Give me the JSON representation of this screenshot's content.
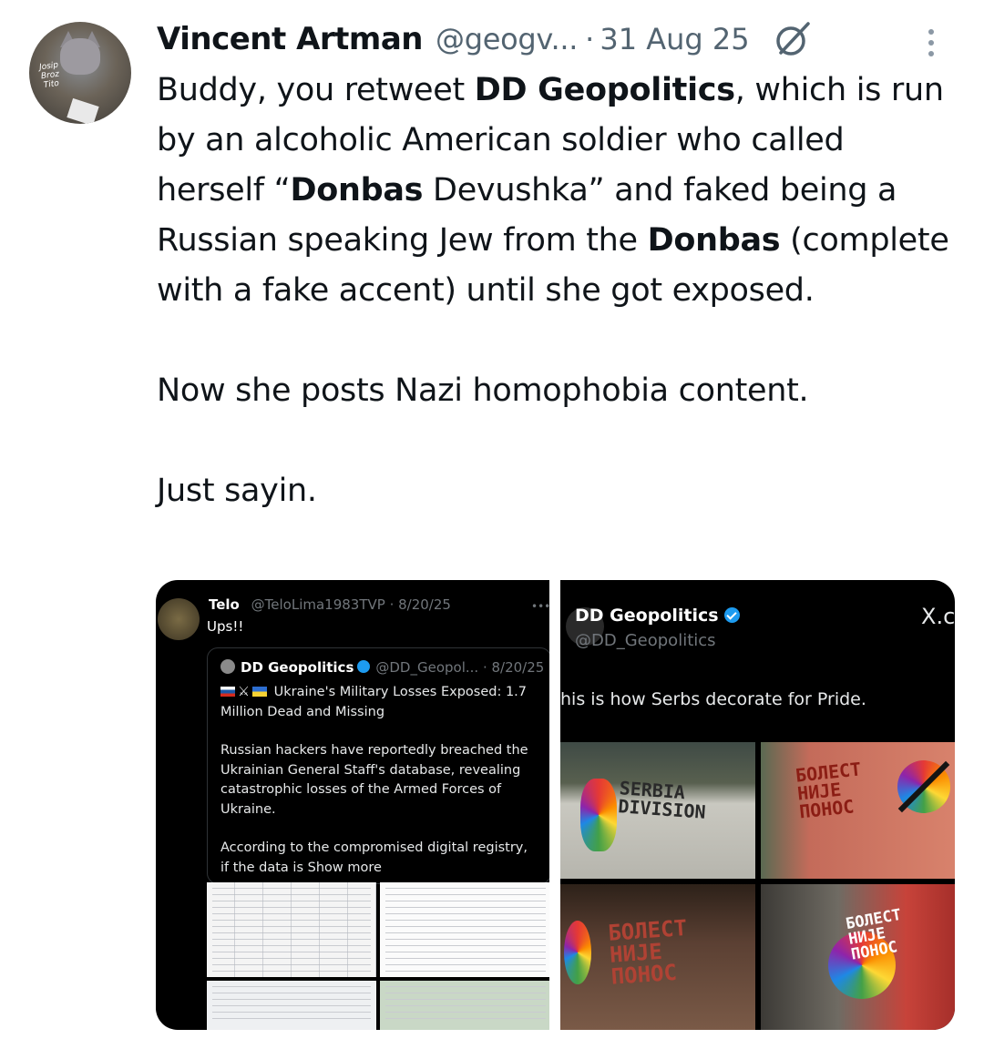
{
  "tweet": {
    "author_name": "Vincent Artman",
    "author_handle": "@geogv...",
    "separator": "·",
    "date": "31 Aug 25",
    "avatar_caption": "Josip Broz Tito",
    "text": {
      "p1_part1": "Buddy, you retweet ",
      "p1_bold1": "DD Geopolitics",
      "p1_part2": ", which is run by an alcoholic American soldier who called herself “",
      "p1_bold2": "Donbas",
      "p1_part3": " Devushka” and faked being a Russian speaking Jew from the ",
      "p1_bold3": "Donbas",
      "p1_part4": " (complete with a fake accent) until she got exposed.",
      "p2": "Now she posts Nazi homophobia content.",
      "p3": "Just sayin."
    }
  },
  "media_left": {
    "author_name": "Telo",
    "author_handle": "@TeloLima1983TVP · 8/20/25",
    "text": "Ups!!",
    "quote": {
      "author_name": "DD Geopolitics",
      "author_handle": "@DD_Geopol... · 8/20/25",
      "headline": "Ukraine's Military Losses Exposed: 1.7 Million Dead and Missing",
      "body": "Russian hackers have reportedly breached the Ukrainian General Staff's database, revealing catastrophic losses of the Armed Forces of Ukraine.",
      "body2": "According to the compromised digital registry, if the data is ",
      "show_more": "Show more"
    }
  },
  "media_right": {
    "author_name": "DD Geopolitics",
    "author_handle": "@DD_Geopolitics",
    "x_label": "X.c",
    "text": "his is how Serbs decorate for Pride.",
    "graffiti": {
      "g1": "SERBIA DIVISION",
      "g2": "БОЛЕСТ НИЈЕ ПОНОС",
      "g3": "БОЛЕСТ НИЈЕ ПОНОС",
      "g4": "БОЛЕСТ НИЈЕ ПОНОС"
    }
  },
  "icons": {
    "grok": "grok-icon",
    "more": "more-vertical-icon",
    "verified": "verified-badge-icon"
  },
  "colors": {
    "text": "#0f1419",
    "secondary": "#536471",
    "verified": "#1d9bf0",
    "media_bg": "#000000"
  }
}
